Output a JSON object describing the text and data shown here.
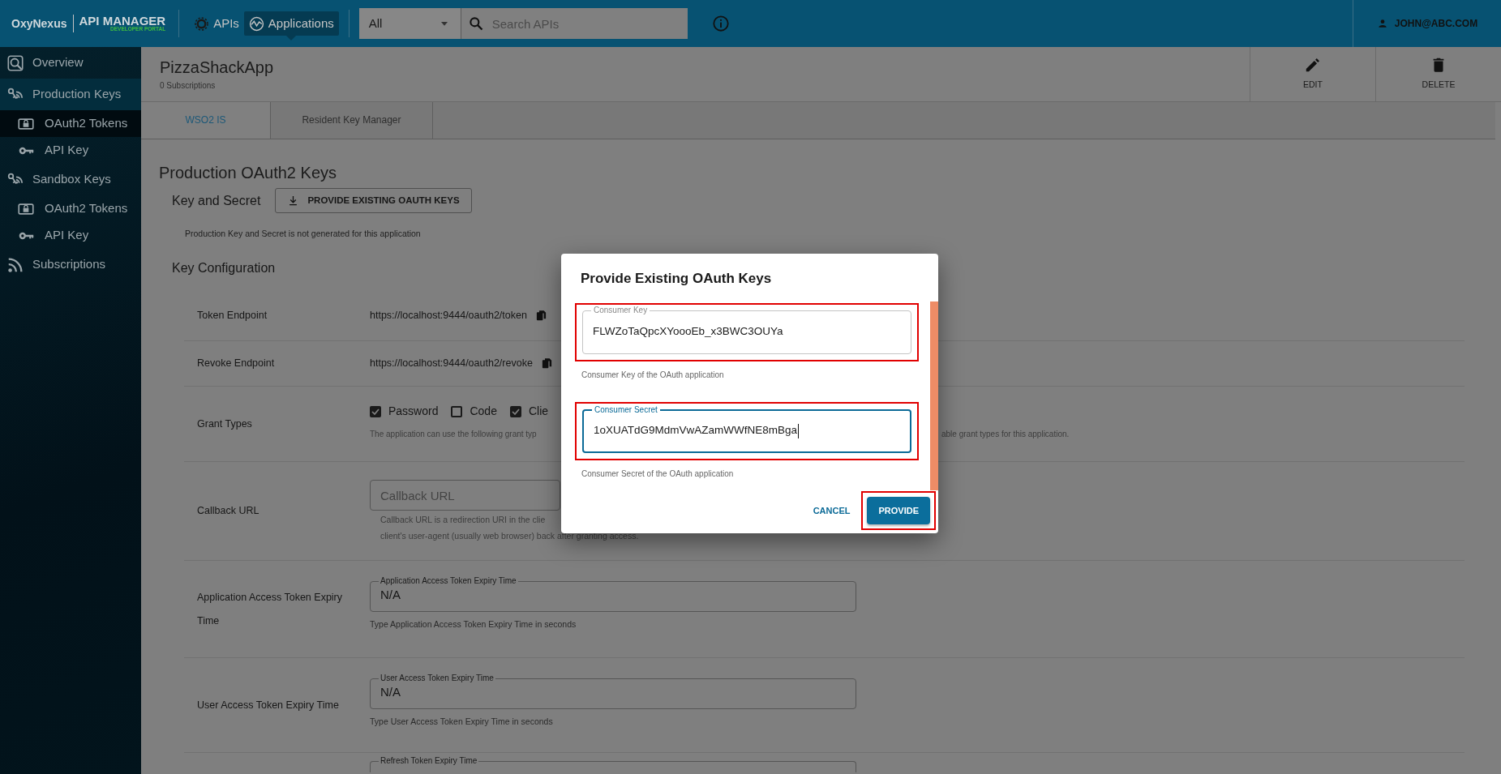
{
  "topbar": {
    "logo": "OxyNexus",
    "product": "API MANAGER",
    "subtitle": "DEVELOPER PORTAL",
    "nav": [
      {
        "label": "APIs",
        "selected": false
      },
      {
        "label": "Applications",
        "selected": true
      }
    ],
    "filter": {
      "value": "All"
    },
    "search": {
      "placeholder": "Search APIs"
    },
    "user": "JOHN@ABC.COM"
  },
  "sidebar": {
    "items": [
      {
        "label": "Overview",
        "selected": false
      },
      {
        "label": "Production Keys",
        "selected": true,
        "children": [
          {
            "label": "OAuth2 Tokens",
            "selected": true
          },
          {
            "label": "API Key",
            "selected": false
          }
        ]
      },
      {
        "label": "Sandbox Keys",
        "selected": false,
        "children": [
          {
            "label": "OAuth2 Tokens",
            "selected": false
          },
          {
            "label": "API Key",
            "selected": false
          }
        ]
      },
      {
        "label": "Subscriptions",
        "selected": false
      }
    ]
  },
  "app": {
    "title": "PizzaShackApp",
    "subtitle": "0 Subscriptions",
    "actions": [
      "EDIT",
      "DELETE"
    ]
  },
  "tabs": [
    {
      "label": "WSO2 IS",
      "selected": true
    },
    {
      "label": "Resident Key Manager",
      "selected": false
    }
  ],
  "section": {
    "title": "Production OAuth2 Keys",
    "key_label": "Key and Secret",
    "key_button": "PROVIDE EXISTING OAUTH KEYS",
    "note": "Production Key and Secret is not generated for this application",
    "config_title": "Key Configuration",
    "rows": [
      {
        "kind": "endpoint",
        "label": "Token Endpoint",
        "value": "https://localhost:9444/oauth2/token"
      },
      {
        "kind": "endpoint",
        "label": "Revoke Endpoint",
        "value": "https://localhost:9444/oauth2/revoke"
      },
      {
        "kind": "grants",
        "label": "Grant Types",
        "options": [
          {
            "label": "Password",
            "checked": true
          },
          {
            "label": "Code",
            "checked": false
          },
          {
            "label": "Clie",
            "checked": true
          }
        ],
        "help": "The application can use the following grant typ",
        "help_after": "able grant types for this application."
      },
      {
        "kind": "url",
        "label": "Callback URL",
        "placeholder": "Callback URL",
        "help": [
          "Callback URL is a redirection URI in the clie",
          "client's user-agent (usually web browser) back after granting access."
        ]
      },
      {
        "kind": "expiry",
        "label": "Application Access Token Expiry Time",
        "legend": "Application Access Token Expiry Time",
        "value": "N/A",
        "help": "Type Application Access Token Expiry Time in seconds"
      },
      {
        "kind": "expiry",
        "label": "User Access Token Expiry Time",
        "legend": "User Access Token Expiry Time",
        "value": "N/A",
        "help": "Type User Access Token Expiry Time in seconds"
      },
      {
        "kind": "legend_only",
        "legend": "Refresh Token Expiry Time"
      }
    ]
  },
  "dialog": {
    "title": "Provide Existing OAuth Keys",
    "fields": [
      {
        "label": "Consumer Key",
        "value": "FLWZoTaQpcXYoooEb_x3BWC3OUYa",
        "help": "Consumer Key of the OAuth application",
        "focused": false,
        "highlighted": true
      },
      {
        "label": "Consumer Secret",
        "value": "1oXUATdG9MdmVwAZamWWfNE8mBga",
        "help": "Consumer Secret of the OAuth application",
        "focused": true,
        "highlighted": true
      }
    ],
    "buttons": [
      {
        "label": "CANCEL",
        "kind": "text",
        "highlighted": false
      },
      {
        "label": "PROVIDE",
        "kind": "primary",
        "highlighted": true
      }
    ]
  }
}
